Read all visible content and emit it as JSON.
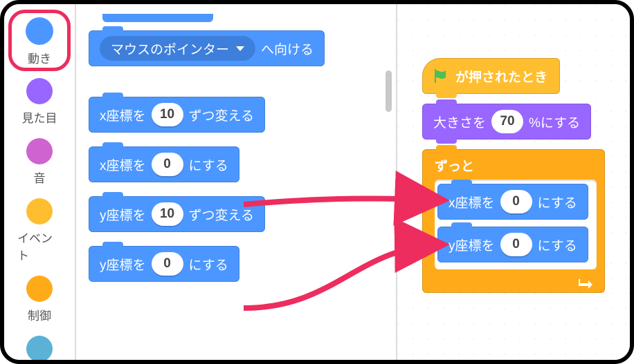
{
  "sidebar": {
    "categories": [
      {
        "label": "動き",
        "color": "#4c97ff"
      },
      {
        "label": "見た目",
        "color": "#9966ff"
      },
      {
        "label": "音",
        "color": "#cf63cf"
      },
      {
        "label": "イベント",
        "color": "#ffbe30"
      },
      {
        "label": "制御",
        "color": "#ffab19"
      },
      {
        "label": "",
        "color": "#5cb1d6"
      }
    ]
  },
  "palette": {
    "point_towards": {
      "prefix": "",
      "option": "マウスのポインター",
      "suffix": " へ向ける"
    },
    "change_x": {
      "prefix": "x座標を",
      "value": "10",
      "suffix": " ずつ変える"
    },
    "set_x": {
      "prefix": "x座標を",
      "value": "0",
      "suffix": " にする"
    },
    "change_y": {
      "prefix": "y座標を",
      "value": "10",
      "suffix": " ずつ変える"
    },
    "set_y": {
      "prefix": "y座標を",
      "value": "0",
      "suffix": " にする"
    }
  },
  "script": {
    "hat": "が押されたとき",
    "set_size": {
      "prefix": "大きさを",
      "value": "70",
      "suffix": " %にする"
    },
    "forever": "ずっと",
    "set_x": {
      "prefix": "x座標を",
      "value": "0",
      "suffix": " にする"
    },
    "set_y": {
      "prefix": "y座標を",
      "value": "0",
      "suffix": " にする"
    }
  },
  "colors": {
    "motion": "#4c97ff",
    "looks": "#9966ff",
    "sound": "#cf63cf",
    "events": "#ffbe30",
    "control": "#ffab19",
    "sensing": "#5cb1d6",
    "annotation": "#ec2d5e"
  }
}
